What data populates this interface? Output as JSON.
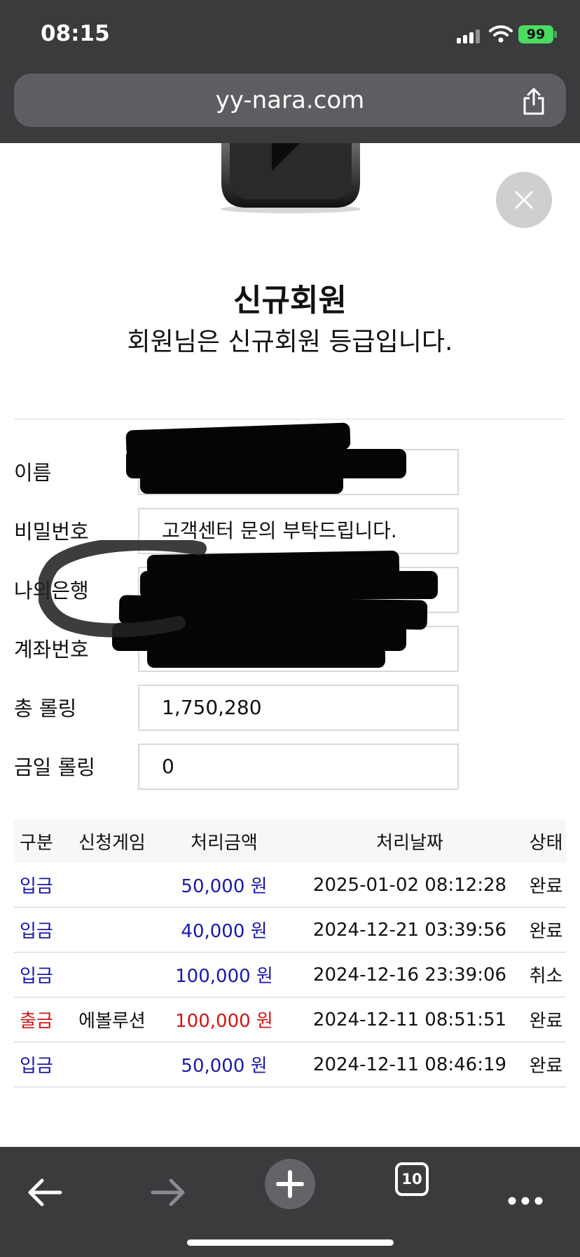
{
  "status_bar": {
    "time": "08:15",
    "battery": "99"
  },
  "browser": {
    "url": "yy-nara.com",
    "tab_count": "10"
  },
  "grade": {
    "title": "신규회원",
    "description": "회원님은 신규회원 등급입니다."
  },
  "form": {
    "name_label": "이름",
    "name_value": "",
    "password_label": "비밀번호",
    "password_value": "고객센터 문의 부탁드립니다.",
    "bank_label": "나의은행",
    "bank_value": "",
    "account_label": "계좌번호",
    "account_value": "",
    "total_rolling_label": "총 롤링",
    "total_rolling_value": "1,750,280",
    "today_rolling_label": "금일 롤링",
    "today_rolling_value": "0"
  },
  "table": {
    "headers": [
      "구분",
      "신청게임",
      "처리금액",
      "처리날짜",
      "상태"
    ],
    "rows": [
      {
        "type": "입금",
        "game": "",
        "amount": "50,000 원",
        "date": "2025-01-02 08:12:28",
        "status": "완료"
      },
      {
        "type": "입금",
        "game": "",
        "amount": "40,000 원",
        "date": "2024-12-21 03:39:56",
        "status": "완료"
      },
      {
        "type": "입금",
        "game": "",
        "amount": "100,000 원",
        "date": "2024-12-16 23:39:06",
        "status": "취소"
      },
      {
        "type": "출금",
        "game": "에볼루션",
        "amount": "100,000 원",
        "date": "2024-12-11 08:51:51",
        "status": "완료"
      },
      {
        "type": "입금",
        "game": "",
        "amount": "50,000 원",
        "date": "2024-12-11 08:46:19",
        "status": "완료"
      }
    ]
  },
  "colors": {
    "deposit": "#1a1aa8",
    "withdraw": "#d31515",
    "bar": "#3a3b3d",
    "battery": "#4cd964"
  },
  "icons": [
    "signal-icon",
    "wifi-icon",
    "share-icon",
    "close-icon",
    "back-arrow-icon",
    "forward-arrow-icon",
    "new-tab-icon",
    "tabs-icon",
    "more-icon"
  ]
}
